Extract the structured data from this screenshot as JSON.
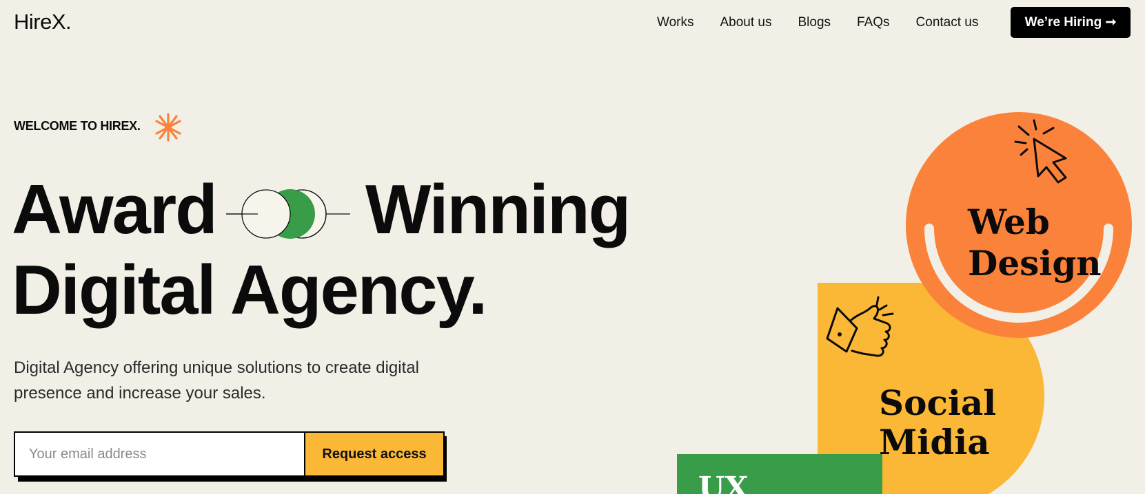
{
  "brand": {
    "logo": "HireX."
  },
  "nav": {
    "items": [
      "Works",
      "About us",
      "Blogs",
      "FAQs",
      "Contact us"
    ],
    "cta_label": "We’re Hiring ➞"
  },
  "hero": {
    "eyebrow": "WELCOME TO HIREX.",
    "headline_line1_a": "Award",
    "headline_line1_b": "Winning",
    "headline_line2": "Digital Agency.",
    "subtitle": "Digital Agency offering unique solutions to create digital presence and increase your sales."
  },
  "signup": {
    "email_placeholder": "Your email address",
    "email_value": "",
    "submit_label": "Request access"
  },
  "services": {
    "web_design_line1": "Web",
    "web_design_line2": "Design",
    "social_line1": "Social",
    "social_line2": "Midia",
    "ux_partial": "UX"
  },
  "colors": {
    "background": "#f2efe7",
    "orange": "#fb823a",
    "yellow": "#fbb736",
    "green": "#389c48",
    "black": "#000000"
  }
}
